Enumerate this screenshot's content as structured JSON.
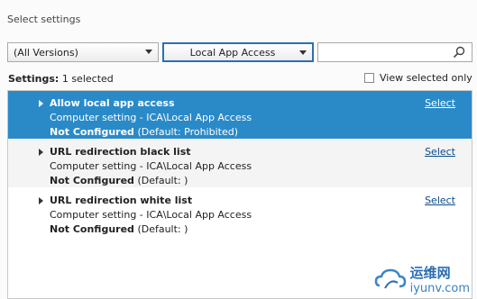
{
  "header": {
    "title": "Select settings"
  },
  "filters": {
    "version": "(All Versions)",
    "category": "Local App Access",
    "search_placeholder": ""
  },
  "summary": {
    "label": "Settings:",
    "count_text": "1 selected",
    "view_selected_label": "View selected only",
    "view_selected_checked": false
  },
  "settings": [
    {
      "title": "Allow local app access",
      "path": "Computer setting - ICA\\Local App Access",
      "status": "Not Configured",
      "default": "(Default: Prohibited)",
      "action": "Select",
      "selected": true
    },
    {
      "title": "URL redirection black list",
      "path": "Computer setting - ICA\\Local App Access",
      "status": "Not Configured",
      "default": "(Default: )",
      "action": "Select",
      "selected": false
    },
    {
      "title": "URL redirection white list",
      "path": "Computer setting - ICA\\Local App Access",
      "status": "Not Configured",
      "default": "(Default: )",
      "action": "Select",
      "selected": false
    }
  ],
  "watermark": {
    "name": "运维网",
    "url": "iyunv.com"
  },
  "colors": {
    "selected_row": "#2a8ac8",
    "accent": "#2b6fb3"
  }
}
